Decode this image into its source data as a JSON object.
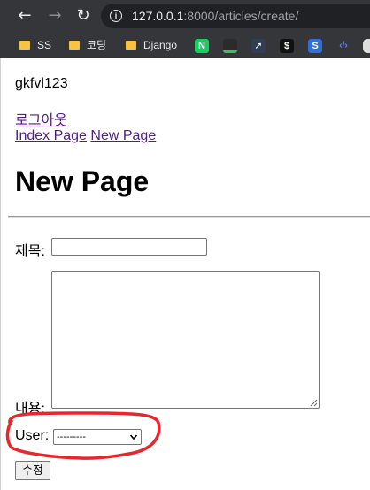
{
  "browser": {
    "url_host": "127.0.0.1",
    "url_rest": ":8000/articles/create/",
    "bookmarks": [
      {
        "label": "SS",
        "icon": "folder-icon"
      },
      {
        "label": "코딩",
        "icon": "folder-icon"
      },
      {
        "label": "Django",
        "icon": "folder-icon"
      },
      {
        "label": "N",
        "icon": "naver-favicon"
      },
      {
        "label": "",
        "icon": "green-bar-favicon"
      },
      {
        "label": "",
        "icon": "bird-favicon"
      },
      {
        "label": "$",
        "icon": "dollar-favicon"
      },
      {
        "label": "S",
        "icon": "s-favicon"
      },
      {
        "label": "‹/›",
        "icon": "code-favicon"
      }
    ]
  },
  "page": {
    "username": "gkfvl123",
    "logout_label": "로그아웃",
    "nav": [
      "Index Page",
      "New Page"
    ],
    "title": "New Page",
    "form": {
      "title_label": "제목:",
      "title_value": "",
      "content_label": "내용:",
      "content_value": "",
      "user_label": "User:",
      "user_selected": "---------",
      "submit_label": "수정"
    }
  },
  "colors": {
    "chrome_bg": "#35363a",
    "link_visited": "#551a8b",
    "annotation_red": "#e8262c"
  }
}
